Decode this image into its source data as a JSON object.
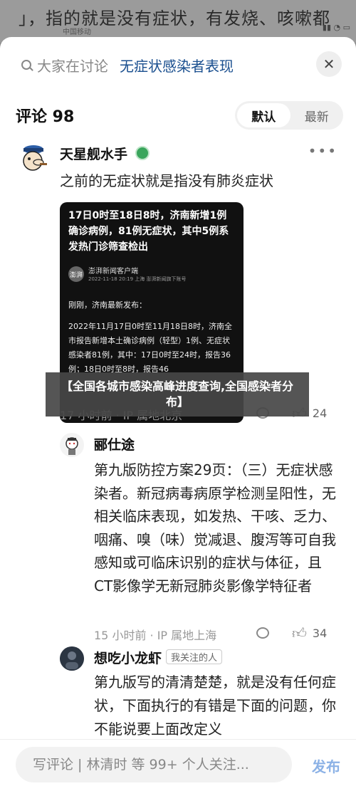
{
  "background": {
    "article_text": "」，指的就是没有症状，有发烧、咳嗽都",
    "status_carrier": "中国移动"
  },
  "search": {
    "placeholder": "大家在讨论",
    "topic": "无症状感染者表现",
    "close_label": "✕"
  },
  "comments_header": {
    "title": "评论 98",
    "sort_options": [
      "默认",
      "最新"
    ],
    "active_sort": "默认"
  },
  "comments": [
    {
      "username": "天星舰水手",
      "text": "之前的无症状就是指没有肺炎症状",
      "image": {
        "headline": "17日0时至18日8时，济南新增1例确诊病例，81例无症状，其中5例系发热门诊筛查检出",
        "source_logo": "澎湃",
        "source_name": "澎湃新闻客户端",
        "source_meta": "2022-11-18 20:19  上海    澎湃新闻旗下账号",
        "body_1": "刚刚，济南最新发布：",
        "body_2": "2022年11月17日0时至11月18日8时，济南全市报告新增本土确诊病例（轻型）1例、无症状感染者81例，其中：17日0时至24时，报告36例；18日0时至8时，报告46"
      },
      "meta": "17 小时前 · IP 属地北京",
      "likes": "24"
    },
    {
      "username": "郦仕途",
      "text": "第九版防控方案29页：（三）无症状感染者。新冠病毒病原学检测呈阳性，无相关临床表现，如发热、干咳、乏力、咽痛、嗅（味）觉减退、腹泻等可自我感知或可临床识别的症状与体征，且CT影像学无新冠肺炎影像学特征者",
      "meta": "15 小时前 · IP 属地上海",
      "likes": "34"
    },
    {
      "username": "想吃小龙虾",
      "badge": "我关注的人",
      "text": "第九版写的清清楚楚，就是没有任何症状，下面执行的有错是下面的问题，你不能说要上面改定义"
    }
  ],
  "overlay_banner": "【全国各城市感染高峰进度查询,全国感染者分布】",
  "bottom": {
    "input_placeholder": "写评论 | 林清时 等 99+ 个人关注...",
    "publish_label": "发布"
  },
  "colors": {
    "topic_blue": "#1a4f8f",
    "publish_blue": "#8cb2e6",
    "verified_green": "#3aa55c"
  }
}
